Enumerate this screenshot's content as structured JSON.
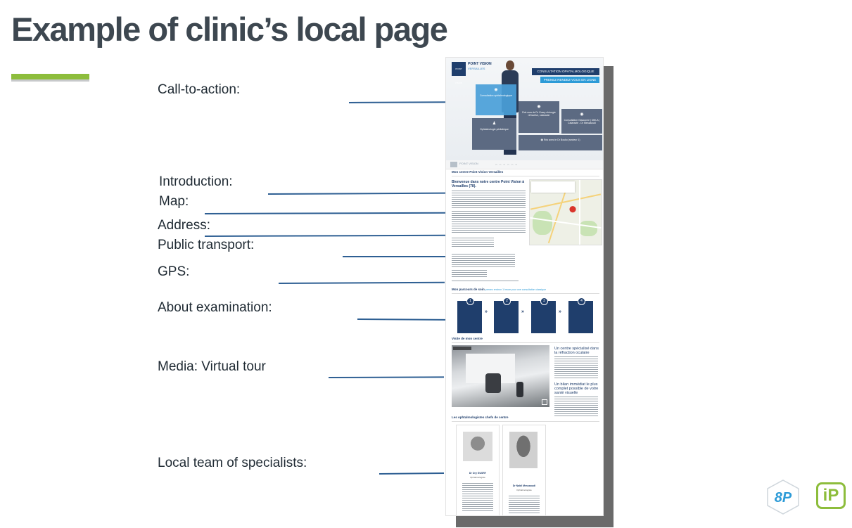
{
  "slide": {
    "title": "Example of clinic’s local page",
    "accent_color": "#8dbd3c",
    "line_color": "#2e5f93"
  },
  "annotations": [
    {
      "id": "cta",
      "label": "Call-to-action:"
    },
    {
      "id": "introduction",
      "label": "Introduction:"
    },
    {
      "id": "map",
      "label": "Map:"
    },
    {
      "id": "address",
      "label": "Address:"
    },
    {
      "id": "public-transport",
      "label": "Public transport:"
    },
    {
      "id": "gps",
      "label": "GPS:"
    },
    {
      "id": "about-examination",
      "label": "About examination:"
    },
    {
      "id": "media",
      "label": "Media: Virtual tour"
    },
    {
      "id": "team",
      "label": "Local team of specialists:"
    }
  ],
  "screenshot": {
    "brand": "POINT VISION",
    "brand_city": "VERSAILLES",
    "logo_text": "POINT VISION",
    "cta_primary": "CONSULTATION OPHTALMOLOGIQUE",
    "cta_secondary": "PRENEZ RENDEZ-VOUS EN LIGNE",
    "tiles": [
      {
        "label": "Consultation ophtalmologique",
        "style": "blue"
      },
      {
        "label": "Rdv avec le Dr Gusry chirurgie réfractive, cataracte",
        "style": "grey"
      },
      {
        "label": "Consultation Glaucome | DMLA | Cataracte - Dr Messaoudi",
        "style": "grey"
      },
      {
        "label": "Ophtalmologie pédiatrique",
        "style": "grey"
      },
      {
        "label": "Rdv avec le Dr Bouko (secteur 1)",
        "style": "grey"
      }
    ],
    "nav_brand": "POINT VISION",
    "section_centre": "Mon centre Point Vision Versailles",
    "intro_heading": "Bienvenue dans notre centre Point Vision à Versailles (78).",
    "section_parcours": "Mon parcours de soin",
    "section_parcours_note": "prenez environ 1 heure pour une consultation classique",
    "steps": [
      "1",
      "2",
      "3",
      "4"
    ],
    "section_visite": "Visite de mon centre",
    "side_heading_1": "Un centre spécialisé dans la réfraction oculaire",
    "side_heading_2": "Un bilan immédiat le plus complet possible de votre santé visuelle",
    "section_team": "Les ophtalmologistes chefs de centre",
    "doctors": [
      {
        "name": "Dr Ory GUSRY",
        "role": "Ophtalmologiste"
      },
      {
        "name": "Dr Nabil Messaoudi",
        "role": "Ophtalmologiste"
      }
    ]
  },
  "logos": {
    "left": "8P",
    "right": "iP"
  }
}
